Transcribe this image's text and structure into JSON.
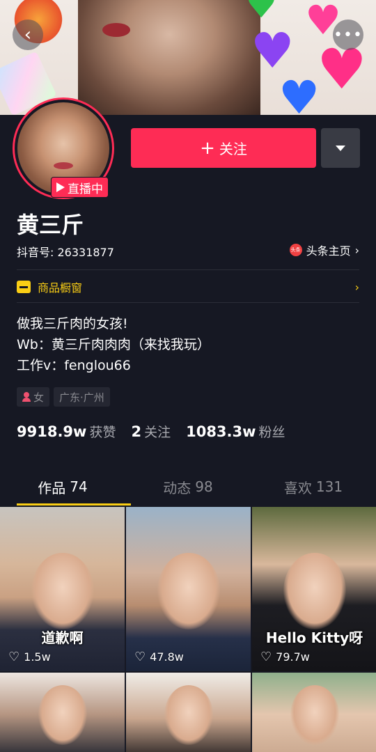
{
  "header": {
    "back_icon": "back-chevron-icon",
    "more_icon": "more-dots-icon",
    "back_glyph": "‹",
    "more_glyph": "•••"
  },
  "profile": {
    "live_label": "直播中",
    "follow_label": "关注",
    "follow_plus": "+",
    "name": "黄三斤",
    "douyin_id": "抖音号: 26331877",
    "toutiao_label": "头条主页",
    "toutiao_logo_text": "头条",
    "shop_label": "商品橱窗",
    "bio_lines": [
      "做我三斤肉的女孩!",
      "Wb：黄三斤肉肉肉（来找我玩）",
      "工作v：fenglou66"
    ],
    "tags": [
      "女",
      "广东·广州"
    ]
  },
  "stats": [
    {
      "num": "9918.9w",
      "label": "获赞"
    },
    {
      "num": "2",
      "label": "关注"
    },
    {
      "num": "1083.3w",
      "label": "粉丝"
    }
  ],
  "tabs": [
    {
      "label": "作品",
      "count": "74",
      "active": true
    },
    {
      "label": "动态",
      "count": "98",
      "active": false
    },
    {
      "label": "喜欢",
      "count": "131",
      "active": false
    }
  ],
  "videos": [
    {
      "caption": "道歉啊",
      "likes": "1.5w"
    },
    {
      "caption": "",
      "likes": "47.8w"
    },
    {
      "caption": "Hello Kitty呀",
      "likes": "79.7w"
    },
    {
      "caption": "",
      "likes": ""
    },
    {
      "caption": "",
      "likes": ""
    },
    {
      "caption": "",
      "likes": ""
    }
  ],
  "colors": {
    "background": "#161823",
    "accent_red": "#fe2c55",
    "accent_yellow": "#face15"
  }
}
